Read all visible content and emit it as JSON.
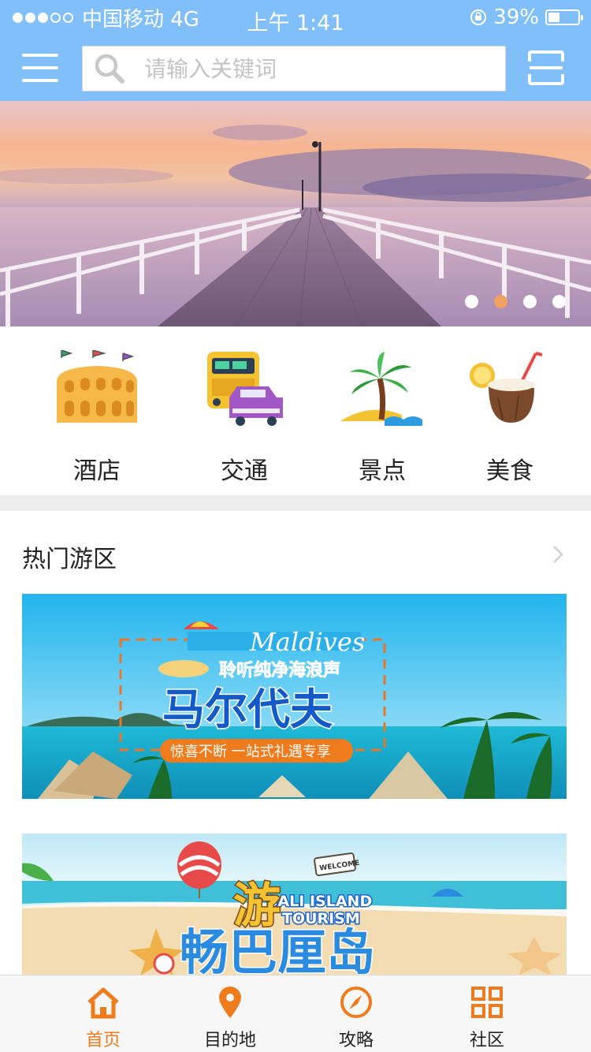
{
  "status_bar": {
    "carrier": "中国移动 4G",
    "time": "上午 1:41",
    "battery": "39%",
    "battery_level": 0.39
  },
  "header": {
    "search_placeholder": "请输入关键词",
    "icons": [
      "menu-icon",
      "search-icon",
      "scan-icon"
    ]
  },
  "banner": {
    "slides": 4,
    "active_index": 1
  },
  "categories": [
    {
      "label": "酒店",
      "icon": "hotel-icon"
    },
    {
      "label": "交通",
      "icon": "transport-icon"
    },
    {
      "label": "景点",
      "icon": "scenic-spot-icon"
    },
    {
      "label": "美食",
      "icon": "food-icon"
    }
  ],
  "hot_section": {
    "title": "热门游区",
    "cards": [
      {
        "en_title": "Maldives",
        "subtitle": "聆听纯净海浪声",
        "title": "马尔代夫",
        "tagline": "惊喜不断 一站式礼遇专享"
      },
      {
        "sign": "WELCOME",
        "en_title_line1": "BALI ISLAND",
        "en_title_line2": "TOURISM",
        "title_top": "游",
        "title": "畅巴厘岛"
      }
    ]
  },
  "tabbar": {
    "tabs": [
      {
        "label": "首页",
        "icon": "home-icon",
        "active": true
      },
      {
        "label": "目的地",
        "icon": "location-pin-icon",
        "active": false
      },
      {
        "label": "攻略",
        "icon": "compass-icon",
        "active": false
      },
      {
        "label": "社区",
        "icon": "grid-icon",
        "active": false
      }
    ]
  },
  "colors": {
    "primary": "#80bff9",
    "accent": "#f07b1c",
    "indicator_active": "#f0a060"
  }
}
